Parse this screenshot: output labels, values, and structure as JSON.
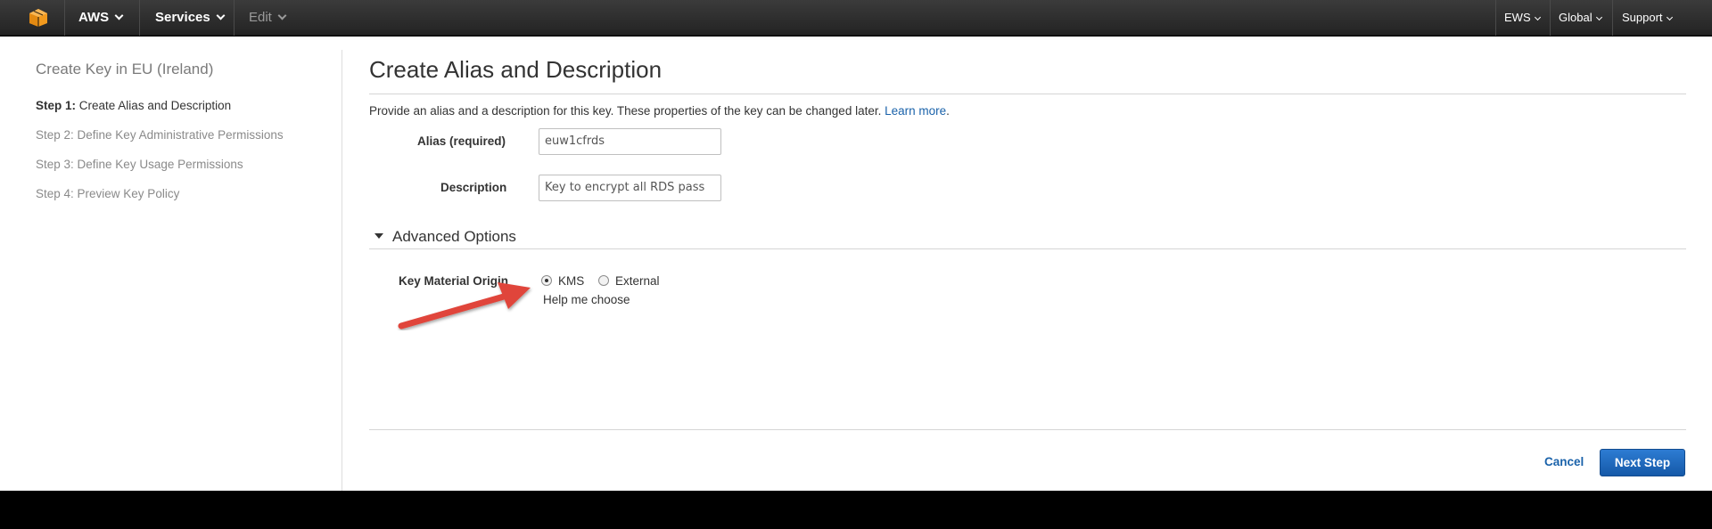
{
  "nav": {
    "brand": "AWS",
    "services": "Services",
    "edit": "Edit",
    "account": "EWS",
    "region": "Global",
    "support": "Support"
  },
  "sidebar": {
    "title": "Create Key in EU (Ireland)",
    "steps": [
      {
        "prefix": "Step 1:",
        "label": "Create Alias and Description"
      },
      {
        "label": "Step 2: Define Key Administrative Permissions"
      },
      {
        "label": "Step 3: Define Key Usage Permissions"
      },
      {
        "label": "Step 4: Preview Key Policy"
      }
    ]
  },
  "main": {
    "title": "Create Alias and Description",
    "intro": "Provide an alias and a description for this key. These properties of the key can be changed later.",
    "learn_more": "Learn more",
    "intro_period": ".",
    "alias_label": "Alias (required)",
    "alias_value": "euw1cfrds",
    "description_label": "Description",
    "description_value": "Key to encrypt all RDS pass",
    "advanced_options": "Advanced Options",
    "key_material_label": "Key Material Origin",
    "origin_options": [
      {
        "label": "KMS",
        "checked": true
      },
      {
        "label": "External",
        "checked": false
      }
    ],
    "help_me_choose": "Help me choose"
  },
  "footer": {
    "cancel": "Cancel",
    "next_step": "Next Step"
  },
  "colors": {
    "link": "#1a62aa",
    "primary_button": "#1f6bc1",
    "annotation_arrow": "#e0453a"
  }
}
